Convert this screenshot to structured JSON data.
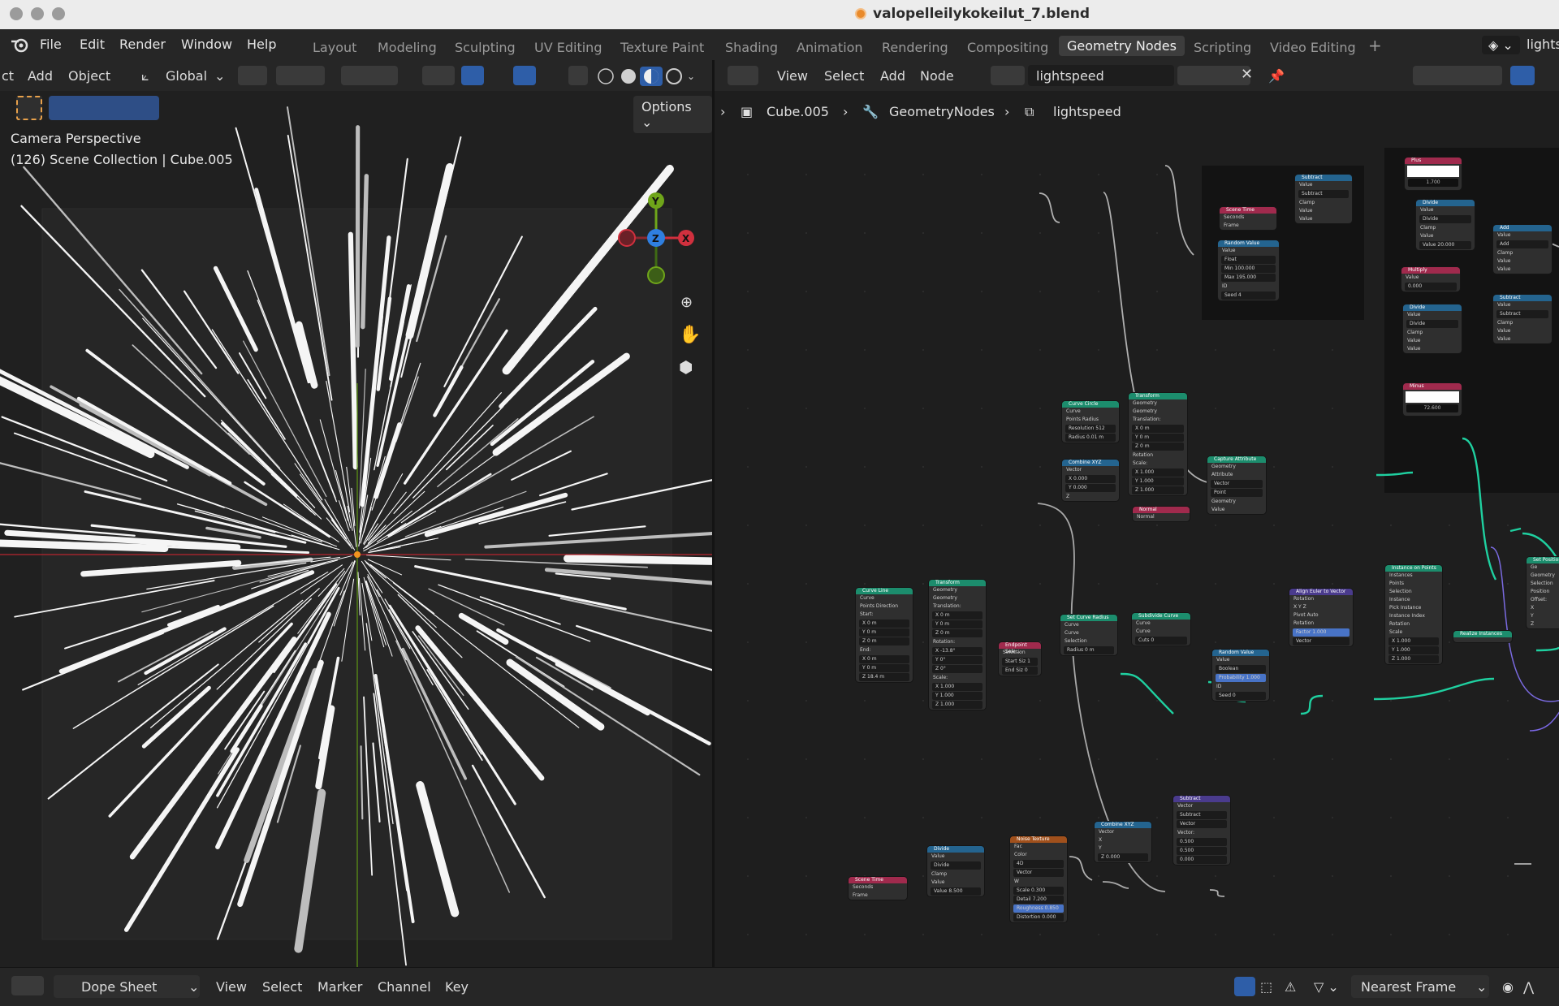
{
  "window": {
    "title": "valopelleilykokeilut_7.blend"
  },
  "menu": [
    "File",
    "Edit",
    "Render",
    "Window",
    "Help"
  ],
  "workspaces": [
    "Layout",
    "Modeling",
    "Sculpting",
    "UV Editing",
    "Texture Paint",
    "Shading",
    "Animation",
    "Rendering",
    "Compositing",
    "Geometry Nodes",
    "Scripting",
    "Video Editing"
  ],
  "active_workspace": "Geometry Nodes",
  "scene_label": "lights",
  "viewport": {
    "menu_left": "ct",
    "menu": [
      "Add",
      "Object"
    ],
    "orientation": "Global",
    "options": "Options",
    "overlay_line1": "Camera Perspective",
    "overlay_line2": "(126) Scene Collection | Cube.005",
    "gizmo": {
      "y": "Y",
      "z": "Z",
      "x": "X"
    }
  },
  "node_editor": {
    "menu": [
      "View",
      "Select",
      "Add",
      "Node"
    ],
    "node_group": "lightspeed",
    "breadcrumb": [
      "Cube.005",
      "GeometryNodes",
      "lightspeed"
    ]
  },
  "nodes": {
    "scene_time_1": {
      "title": "Scene Time",
      "rows": [
        "Seconds",
        "Frame"
      ]
    },
    "subtract_1": {
      "title": "Subtract",
      "rows": [
        "Value",
        "Subtract",
        "Clamp",
        "Value",
        "Value"
      ]
    },
    "random_value_1": {
      "title": "Random Value",
      "rows": [
        "Value",
        "Float",
        "Min   100.000",
        "Max   195.000",
        "ID",
        "Seed   4"
      ]
    },
    "plus": {
      "title": "Plus",
      "value": "1.700"
    },
    "divide_1": {
      "title": "Divide",
      "rows": [
        "Value",
        "Divide",
        "Clamp",
        "Value",
        "Value   20.000"
      ]
    },
    "multiply": {
      "title": "Multiply",
      "rows": [
        "Value",
        "0.000"
      ]
    },
    "divide_2": {
      "title": "Divide",
      "rows": [
        "Value",
        "Divide",
        "Clamp",
        "Value",
        "Value"
      ]
    },
    "add_1": {
      "title": "Add",
      "rows": [
        "Value",
        "Add",
        "Clamp",
        "Value",
        "Value"
      ]
    },
    "subtract_2": {
      "title": "Subtract",
      "rows": [
        "Value",
        "Subtract",
        "Clamp",
        "Value",
        "Value"
      ]
    },
    "minus": {
      "title": "Minus",
      "value": "72.600"
    },
    "curve_circle": {
      "title": "Curve Circle",
      "rows": [
        "Curve",
        "Points   Radius",
        "Resolution   512",
        "Radius   0.01 m"
      ]
    },
    "transform_1": {
      "title": "Transform",
      "rows": [
        "Geometry",
        "Geometry",
        "Translation:",
        "X   0 m",
        "Y   0 m",
        "Z   0 m",
        "Rotation",
        "Scale:",
        "X   1.000",
        "Y   1.000",
        "Z   1.000"
      ]
    },
    "combine_xyz_1": {
      "title": "Combine XYZ",
      "rows": [
        "Vector",
        "X   0.000",
        "Y   0.000",
        "Z"
      ]
    },
    "normal": {
      "title": "Normal",
      "rows": [
        "Normal"
      ]
    },
    "capture_attribute": {
      "title": "Capture Attribute",
      "rows": [
        "Geometry",
        "Attribute",
        "Vector",
        "Point",
        "Geometry",
        "Value"
      ]
    },
    "curve_line": {
      "title": "Curve Line",
      "rows": [
        "Curve",
        "Points   Direction",
        "Start:",
        "X   0 m",
        "Y   0 m",
        "Z   0 m",
        "End:",
        "X   0 m",
        "Y   0 m",
        "Z   18.4 m"
      ]
    },
    "transform_2": {
      "title": "Transform",
      "rows": [
        "Geometry",
        "Geometry",
        "Translation:",
        "X   0 m",
        "Y   0 m",
        "Z   0 m",
        "Rotation:",
        "X   -13.8°",
        "Y   0°",
        "Z   0°",
        "Scale:",
        "X   1.000",
        "Y   1.000",
        "Z   1.000"
      ]
    },
    "endpoint_selection": {
      "title": "Endpoint Sele...",
      "rows": [
        "Selection",
        "Start Siz   1",
        "End Siz   0"
      ]
    },
    "set_curve_radius": {
      "title": "Set Curve Radius",
      "rows": [
        "Curve",
        "Curve",
        "Selection",
        "Radius   0 m"
      ]
    },
    "subdivide_curve": {
      "title": "Subdivide Curve",
      "rows": [
        "Curve",
        "Curve",
        "Cuts   0"
      ]
    },
    "align_euler": {
      "title": "Align Euler to Vector",
      "rows": [
        "Rotation",
        "X   Y   Z",
        "Pivot   Auto",
        "Rotation",
        "Factor   1.000",
        "Vector"
      ]
    },
    "random_value_2": {
      "title": "Random Value",
      "rows": [
        "Value",
        "Boolean",
        "Probability   1.000",
        "ID",
        "Seed   0"
      ]
    },
    "instance_on_points": {
      "title": "Instance on Points",
      "rows": [
        "Instances",
        "Points",
        "Selection",
        "Instance",
        "Pick Instance",
        "Instance Index",
        "Rotation",
        "Scale",
        "X   1.000",
        "Y   1.000",
        "Z   1.000"
      ]
    },
    "realize_instances": {
      "title": "Realize Instances"
    },
    "set_position": {
      "title": "Set Position",
      "rows": [
        "Ge",
        "Geometry",
        "Selection",
        "Position",
        "Offset:",
        "X",
        "Y",
        "Z"
      ]
    },
    "scene_time_2": {
      "title": "Scene Time",
      "rows": [
        "Seconds",
        "Frame"
      ]
    },
    "divide_3": {
      "title": "Divide",
      "rows": [
        "Value",
        "Divide",
        "Clamp",
        "Value",
        "Value   8.500"
      ]
    },
    "noise_texture": {
      "title": "Noise Texture",
      "rows": [
        "Fac",
        "Color",
        "4D",
        "Vector",
        "W",
        "Scale   0.300",
        "Detail   7.200",
        "Roughness   0.850",
        "Distortion   0.000"
      ]
    },
    "combine_xyz_2": {
      "title": "Combine XYZ",
      "rows": [
        "Vector",
        "X",
        "Y",
        "Z   0.000"
      ]
    },
    "subtract_vec": {
      "title": "Subtract",
      "rows": [
        "Vector",
        "Subtract",
        "Vector",
        "Vector:",
        "0.500",
        "0.500",
        "0.000"
      ]
    }
  },
  "bottom": {
    "editor": "Dope Sheet",
    "menu": [
      "View",
      "Select",
      "Marker",
      "Channel",
      "Key"
    ],
    "snap": "Nearest Frame"
  }
}
